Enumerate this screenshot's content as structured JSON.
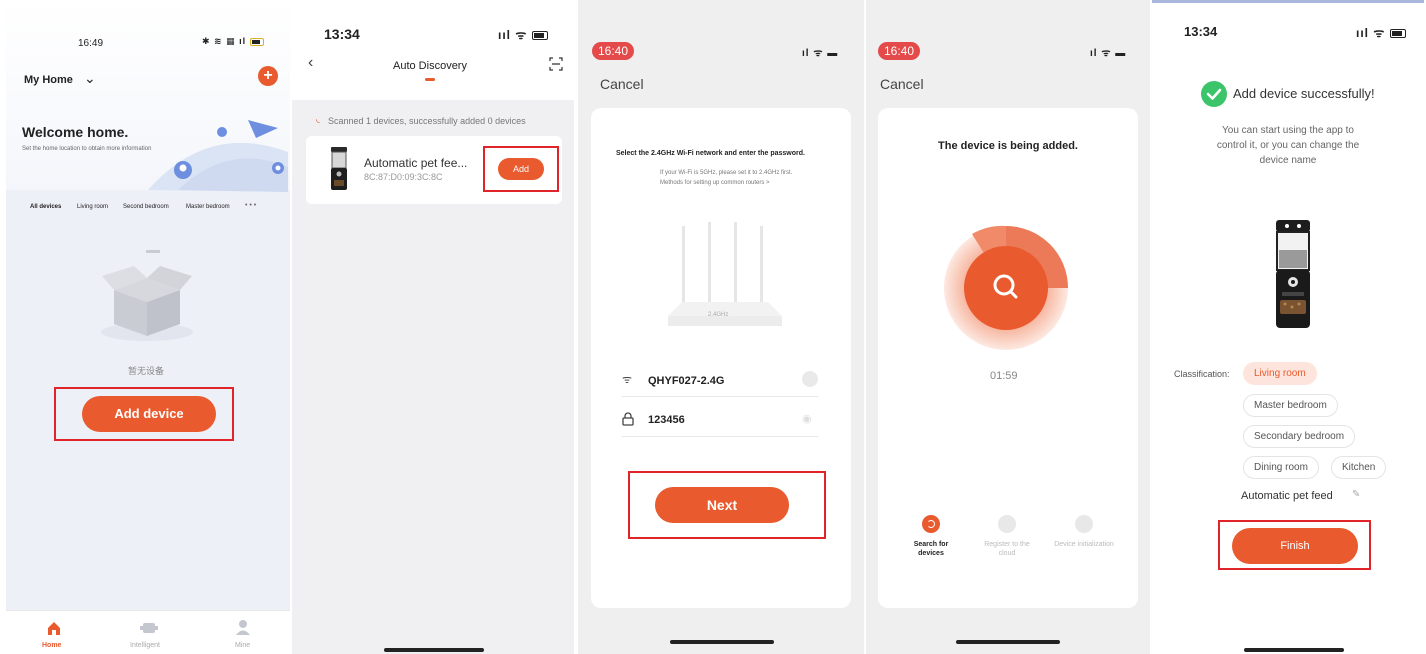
{
  "s1": {
    "time": "16:49",
    "home_selector": "My Home",
    "welcome_title": "Welcome home.",
    "welcome_sub": "Set the home location to obtain more information",
    "rooms": [
      "All devices",
      "Living room",
      "Second bedroom",
      "Master bedroom",
      "• • •"
    ],
    "empty_text": "暂无设备",
    "add_device": "Add device",
    "nav": [
      {
        "label": "Home",
        "icon": "home-icon"
      },
      {
        "label": "Intelligent",
        "icon": "intelligent-icon"
      },
      {
        "label": "Mine",
        "icon": "user-icon"
      }
    ]
  },
  "s2": {
    "time": "13:34",
    "title": "Auto Discovery",
    "scan_text": "Scanned 1 devices, successfully added 0 devices",
    "device_name": "Automatic pet fee...",
    "device_mac": "8C:87:D0:09:3C:8C",
    "add_label": "Add"
  },
  "s3": {
    "time": "16:40",
    "cancel": "Cancel",
    "heading": "Select the 2.4GHz Wi-Fi network and enter the password.",
    "hint1": "If your Wi-Fi is 5GHz, please set it to 2.4GHz first.",
    "hint2": "Methods for setting up common routers >",
    "router_label": "2.4GHz",
    "ssid": "QHYF027-2.4G",
    "password": "123456",
    "next": "Next"
  },
  "s4": {
    "time": "16:40",
    "cancel": "Cancel",
    "heading": "The device is being added.",
    "timer": "01:59",
    "steps": [
      "Search for devices",
      "Register to the cloud",
      "Device initialization"
    ]
  },
  "s5": {
    "time": "13:34",
    "success_title": "Add device successfully!",
    "success_text_1": "You can start using the app to",
    "success_text_2": "control it, or you can change the",
    "success_text_3": "device name",
    "classification_label": "Classification:",
    "rooms": [
      "Living room",
      "Master bedroom",
      "Secondary bedroom",
      "Dining room",
      "Kitchen"
    ],
    "device_name": "Automatic pet feed",
    "finish": "Finish"
  },
  "colors": {
    "accent": "#e95a2e",
    "highlight_box": "#e0242a",
    "success": "#3cc46a",
    "status_pill": "#e44a4a"
  }
}
